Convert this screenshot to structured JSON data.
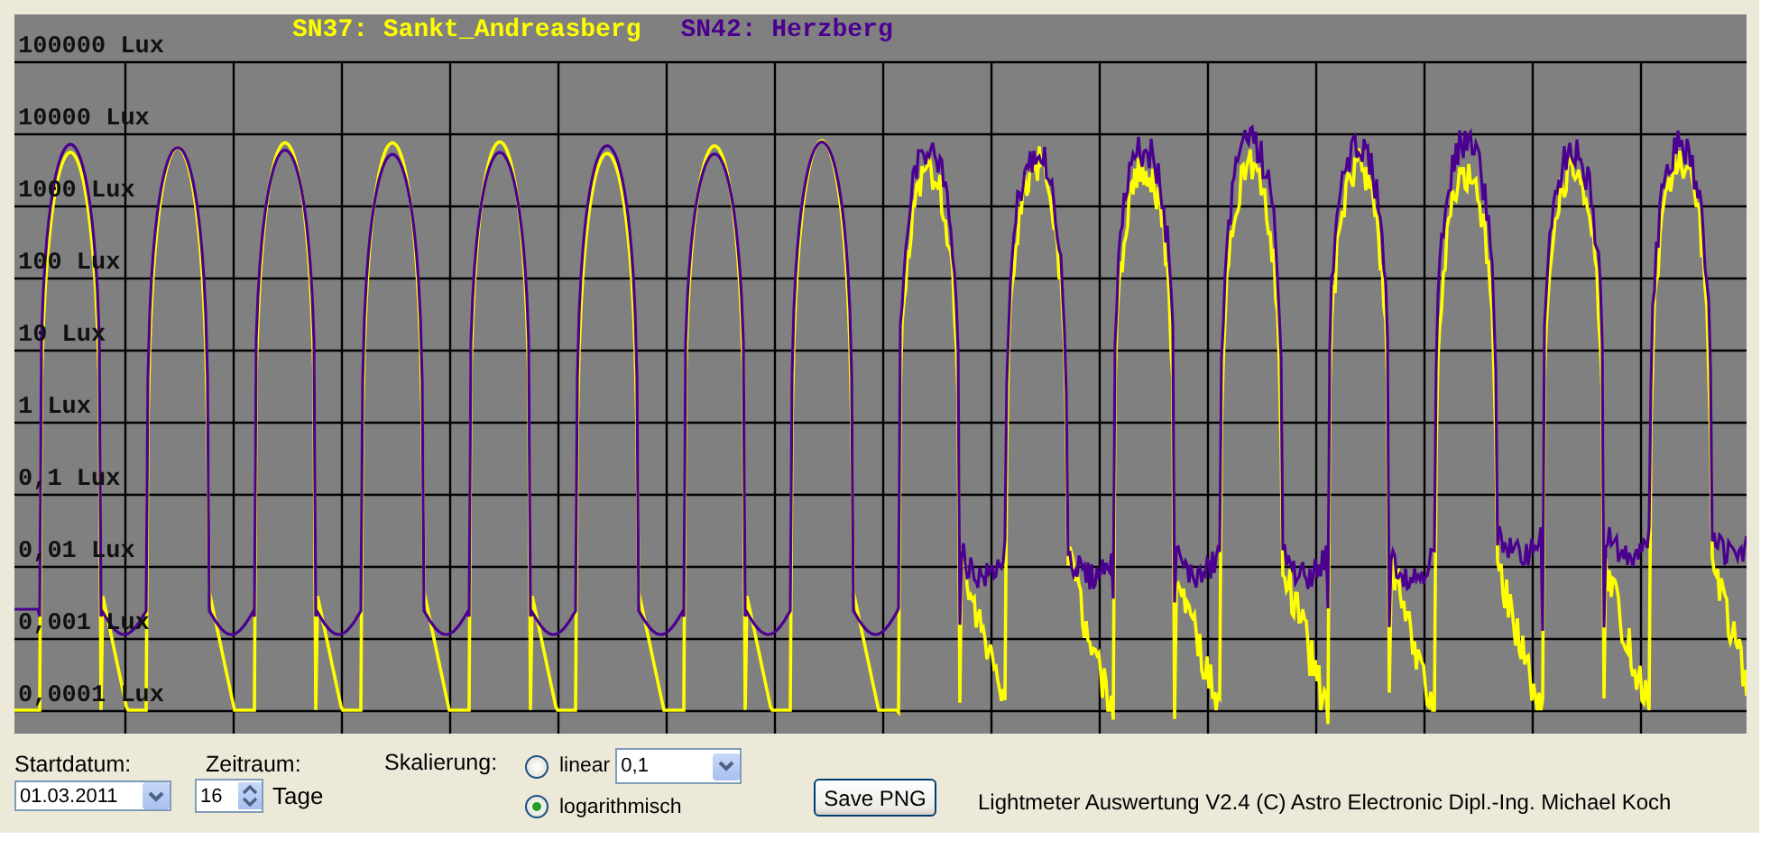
{
  "chart": {
    "legend": [
      {
        "label": "SN37: Sankt_Andreasberg",
        "color": "#ffff00"
      },
      {
        "label": "SN42: Herzberg",
        "color": "#4b0090"
      }
    ],
    "y_labels": [
      "100000 Lux",
      "10000 Lux",
      "1000 Lux",
      "100 Lux",
      "10 Lux",
      "1 Lux",
      "0,1 Lux",
      "0,01 Lux",
      "0,001 Lux",
      "0,0001 Lux"
    ]
  },
  "controls": {
    "start_date": {
      "label": "Startdatum:",
      "value": "01.03.2011"
    },
    "period": {
      "label": "Zeitraum:",
      "value": "16",
      "unit": "Tage"
    },
    "scaling": {
      "label": "Skalierung:",
      "options": [
        {
          "label": "linear",
          "selected": false
        },
        {
          "label": "logarithmisch",
          "selected": true
        }
      ],
      "linear_value": "0,1"
    },
    "save_button": "Save PNG",
    "footer": "Lightmeter Auswertung V2.4  (C) Astro Electronic Dipl.-Ing. Michael Koch"
  }
}
